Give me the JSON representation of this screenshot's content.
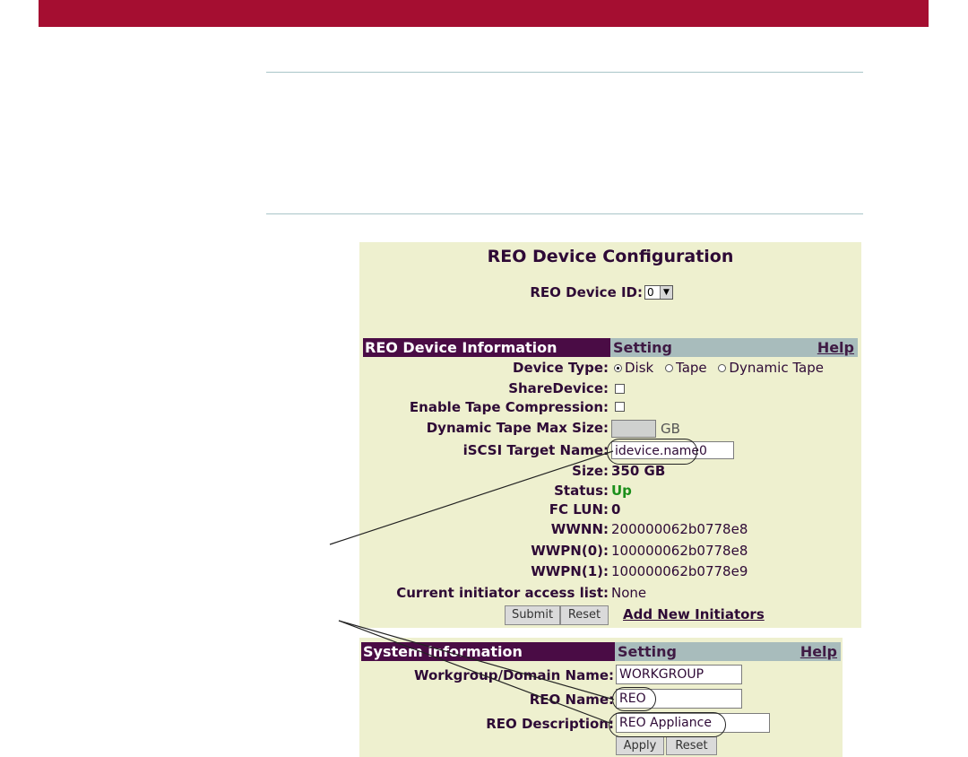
{
  "device_panel": {
    "title": "REO Device Configuration",
    "device_id_label": "REO Device ID:",
    "device_id_value": "0",
    "section_header": "REO Device Information",
    "setting_header": "Setting",
    "help_link": "Help",
    "device_type_label": "Device Type:",
    "device_type_options": [
      "Disk",
      "Tape",
      "Dynamic Tape"
    ],
    "device_type_selected": "Disk",
    "share_device_label": "ShareDevice:",
    "tape_compression_label": "Enable Tape Compression:",
    "dyn_tape_label": "Dynamic Tape Max Size:",
    "dyn_tape_unit": "GB",
    "iscsi_label": "iSCSI Target Name:",
    "iscsi_value": "idevice.name0",
    "size_label": "Size:",
    "size_value": "350 GB",
    "status_label": "Status:",
    "status_value": "Up",
    "status_color": "#1b8f1b",
    "fclun_label": "FC LUN:",
    "fclun_value": "0",
    "wwnn_label": "WWNN:",
    "wwnn_value": "200000062b0778e8",
    "wwpn0_label": "WWPN(0):",
    "wwpn0_value": "100000062b0778e8",
    "wwpn1_label": "WWPN(1):",
    "wwpn1_value": "100000062b0778e9",
    "initiator_label": "Current initiator access list:",
    "initiator_value": "None",
    "submit_label": "Submit",
    "reset_label": "Reset",
    "add_initiators_label": "Add New Initiators"
  },
  "system_panel": {
    "section_header": "System information",
    "setting_header": "Setting",
    "help_link": "Help",
    "workgroup_label": "Workgroup/Domain Name:",
    "workgroup_value": "WORKGROUP",
    "reo_name_label": "REO Name:",
    "reo_name_value": "REO",
    "reo_desc_label": "REO Description:",
    "reo_desc_value": "REO Appliance",
    "apply_label": "Apply",
    "reset_label": "Reset"
  },
  "colors": {
    "banner": "#a50e31",
    "panel_bg": "#eef0cf",
    "header_dark": "#4a0c45",
    "header_light": "#a8bcbc"
  }
}
